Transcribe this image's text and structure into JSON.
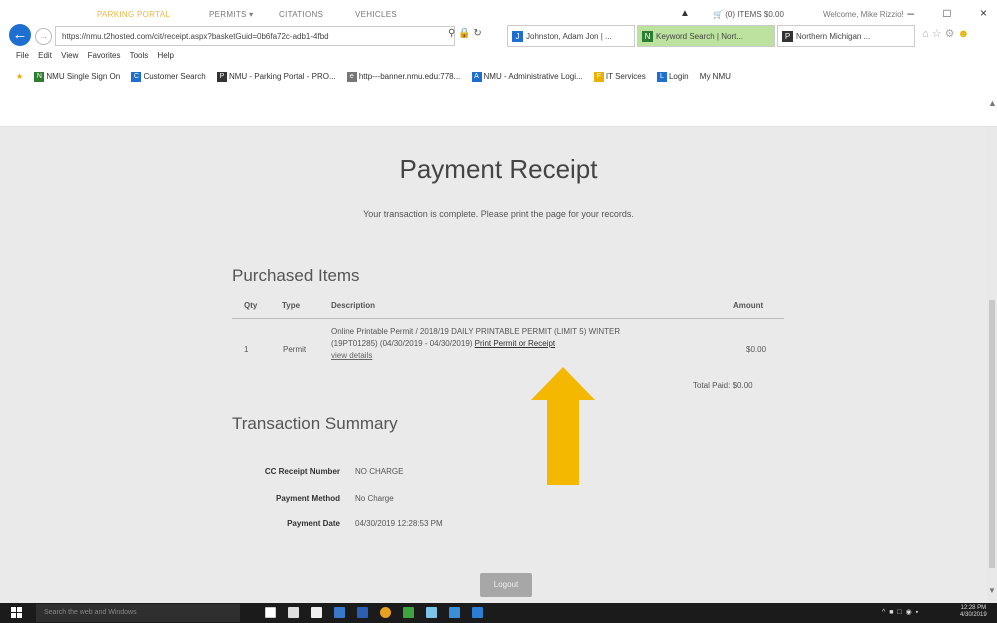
{
  "browser": {
    "window_controls": [
      "–",
      "□",
      "×"
    ],
    "address": "https://nmu.t2hosted.com/cit/receipt.aspx?basketGuid=0b6fa72c-adb1-4fbd",
    "tabs": [
      "Johnston, Adam Jon | ...",
      "Keyword Search | Nort...",
      "Northern Michigan ..."
    ],
    "menu": [
      "File",
      "Edit",
      "View",
      "Favorites",
      "Tools",
      "Help"
    ],
    "favorites": [
      "NMU Single Sign On",
      "Customer Search",
      "NMU - Parking Portal - PRO...",
      "http---banner.nmu.edu:778...",
      "NMU - Administrative Logi...",
      "IT Services",
      "Login",
      "My NMU"
    ]
  },
  "nav": {
    "portal": "PARKING PORTAL",
    "permits": "PERMITS ▾",
    "citations": "CITATIONS",
    "vehicles": "VEHICLES",
    "cart": "(0) ITEMS $0.00",
    "welcome": "Welcome, Mike Rizzio!"
  },
  "page": {
    "title": "Payment Receipt",
    "subtitle": "Your transaction is complete. Please print the page for your records."
  },
  "purchased": {
    "heading": "Purchased Items",
    "columns": [
      "Qty",
      "Type",
      "Description",
      "Amount"
    ],
    "rows": [
      {
        "qty": "1",
        "type": "Permit",
        "desc_line1": "Online Printable Permit / 2018/19 DAILY PRINTABLE PERMIT (LIMIT 5) WINTER",
        "desc_line2": "(19PT01285) (04/30/2019 - 04/30/2019)",
        "print_link": "Print Permit or Receipt",
        "view_details": "view details",
        "amount": "$0.00"
      }
    ],
    "total": "Total Paid: $0.00"
  },
  "summary": {
    "heading": "Transaction Summary",
    "fields": [
      {
        "label": "CC Receipt Number",
        "value": "NO CHARGE"
      },
      {
        "label": "Payment Method",
        "value": "No Charge"
      },
      {
        "label": "Payment Date",
        "value": "04/30/2019 12:28:53 PM"
      }
    ]
  },
  "logout_label": "Logout",
  "colors": {
    "accent_arrow": "#f5b800",
    "portal_accent": "#e8b84b",
    "tab_active": "#bde2a0"
  },
  "taskbar": {
    "search_placeholder": "Search the web and Windows",
    "clock_time": "12:28 PM",
    "clock_date": "4/30/2019"
  }
}
